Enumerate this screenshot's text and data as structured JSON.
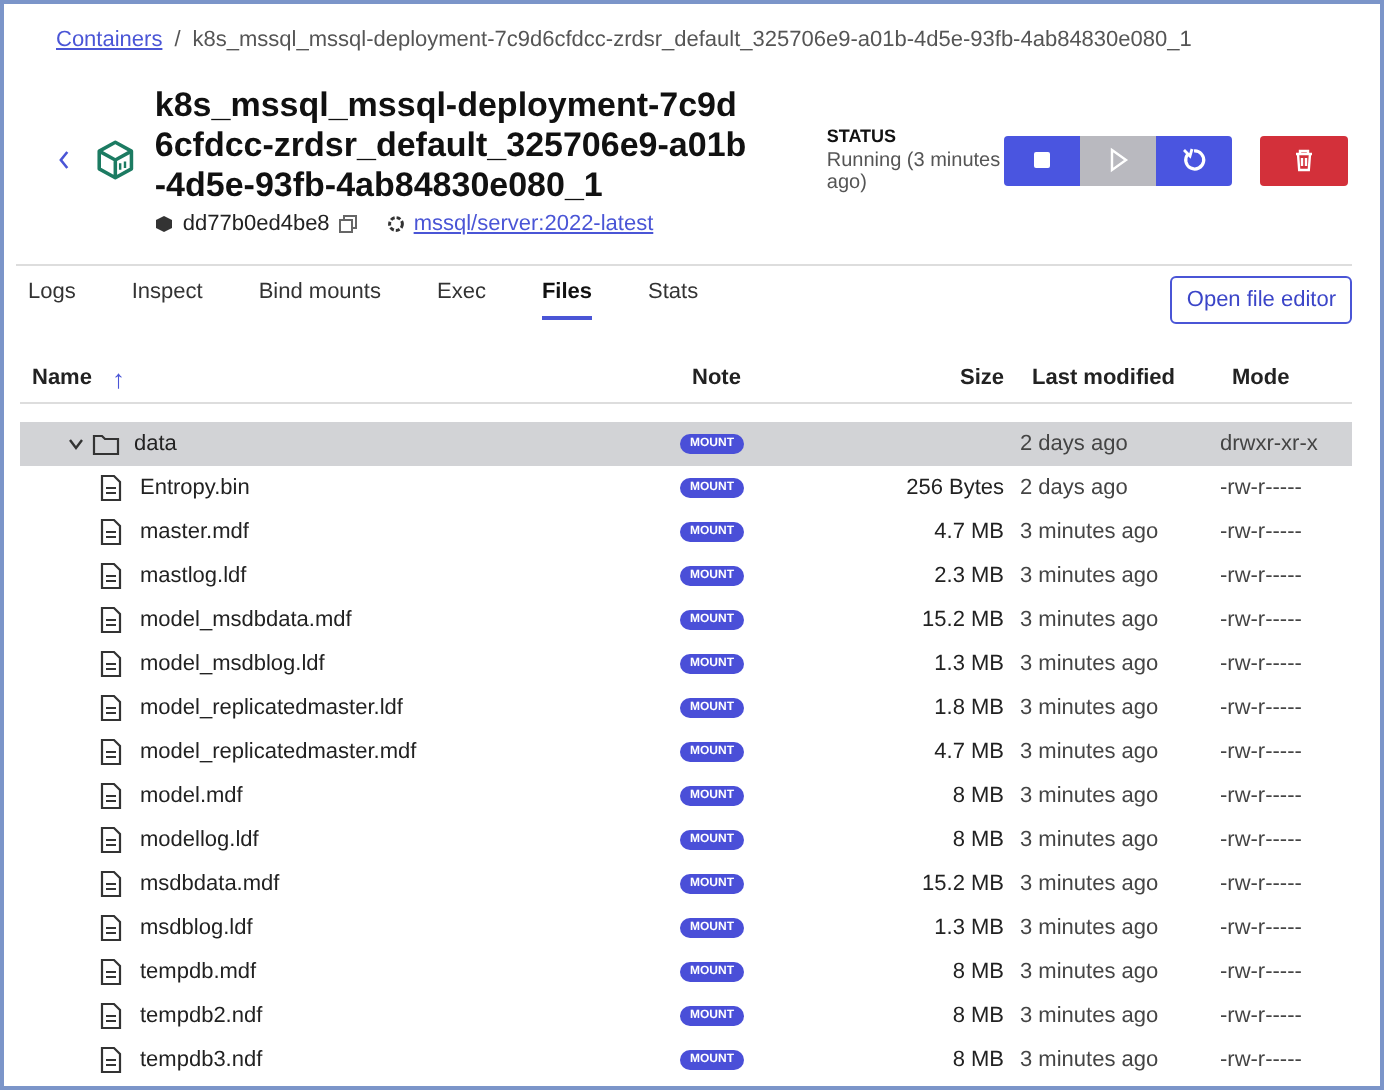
{
  "breadcrumb": {
    "link": "Containers",
    "separator": "/",
    "current": "k8s_mssql_mssql-deployment-7c9d6cfdcc-zrdsr_default_325706e9-a01b-4d5e-93fb-4ab84830e080_1"
  },
  "container": {
    "name": "k8s_mssql_mssql-deployment-7c9d6cfdcc-zrdsr_default_325706e9-a01b-4d5e-93fb-4ab84830e080_1",
    "id": "dd77b0ed4be8",
    "image": "mssql/server:2022-latest"
  },
  "status": {
    "label": "STATUS",
    "value": "Running (3 minutes ago)"
  },
  "actions": [
    {
      "kind": "stop",
      "disabled": false
    },
    {
      "kind": "start",
      "disabled": true
    },
    {
      "kind": "restart",
      "disabled": false
    },
    {
      "kind": "delete",
      "disabled": false
    }
  ],
  "tabs": [
    {
      "label": "Logs",
      "selected": false
    },
    {
      "label": "Inspect",
      "selected": false
    },
    {
      "label": "Bind mounts",
      "selected": false
    },
    {
      "label": "Exec",
      "selected": false
    },
    {
      "label": "Files",
      "selected": true
    },
    {
      "label": "Stats",
      "selected": false
    }
  ],
  "open_file_editor": "Open file editor",
  "table": {
    "columns": [
      "Name",
      "Note",
      "Size",
      "Last modified",
      "Mode"
    ],
    "sort_icon": "↑",
    "rows": [
      {
        "kind": "folder",
        "name": "data",
        "expanded": true,
        "selected": true,
        "note": "MOUNT",
        "modified": "2 days ago",
        "mode": "drwxr-xr-x",
        "children": [
          {
            "kind": "file",
            "name": "Entropy.bin",
            "selected": false,
            "note": "MOUNT",
            "size": "256 Bytes",
            "modified": "2 days ago",
            "mode": "-rw-r-----"
          },
          {
            "kind": "file",
            "name": "master.mdf",
            "selected": false,
            "note": "MOUNT",
            "size": "4.7 MB",
            "modified": "3 minutes ago",
            "mode": "-rw-r-----"
          },
          {
            "kind": "file",
            "name": "mastlog.ldf",
            "selected": false,
            "note": "MOUNT",
            "size": "2.3 MB",
            "modified": "3 minutes ago",
            "mode": "-rw-r-----"
          },
          {
            "kind": "file",
            "name": "model_msdbdata.mdf",
            "selected": false,
            "note": "MOUNT",
            "size": "15.2 MB",
            "modified": "3 minutes ago",
            "mode": "-rw-r-----"
          },
          {
            "kind": "file",
            "name": "model_msdblog.ldf",
            "selected": false,
            "note": "MOUNT",
            "size": "1.3 MB",
            "modified": "3 minutes ago",
            "mode": "-rw-r-----"
          },
          {
            "kind": "file",
            "name": "model_replicatedmaster.ldf",
            "selected": false,
            "note": "MOUNT",
            "size": "1.8 MB",
            "modified": "3 minutes ago",
            "mode": "-rw-r-----"
          },
          {
            "kind": "file",
            "name": "model_replicatedmaster.mdf",
            "selected": false,
            "note": "MOUNT",
            "size": "4.7 MB",
            "modified": "3 minutes ago",
            "mode": "-rw-r-----"
          },
          {
            "kind": "file",
            "name": "model.mdf",
            "selected": false,
            "note": "MOUNT",
            "size": "8 MB",
            "modified": "3 minutes ago",
            "mode": "-rw-r-----"
          },
          {
            "kind": "file",
            "name": "modellog.ldf",
            "selected": false,
            "note": "MOUNT",
            "size": "8 MB",
            "modified": "3 minutes ago",
            "mode": "-rw-r-----"
          },
          {
            "kind": "file",
            "name": "msdbdata.mdf",
            "selected": false,
            "note": "MOUNT",
            "size": "15.2 MB",
            "modified": "3 minutes ago",
            "mode": "-rw-r-----"
          },
          {
            "kind": "file",
            "name": "msdblog.ldf",
            "selected": false,
            "note": "MOUNT",
            "size": "1.3 MB",
            "modified": "3 minutes ago",
            "mode": "-rw-r-----"
          },
          {
            "kind": "file",
            "name": "tempdb.mdf",
            "selected": false,
            "note": "MOUNT",
            "size": "8 MB",
            "modified": "3 minutes ago",
            "mode": "-rw-r-----"
          },
          {
            "kind": "file",
            "name": "tempdb2.ndf",
            "selected": false,
            "note": "MOUNT",
            "size": "8 MB",
            "modified": "3 minutes ago",
            "mode": "-rw-r-----"
          },
          {
            "kind": "file",
            "name": "tempdb3.ndf",
            "selected": false,
            "note": "MOUNT",
            "size": "8 MB",
            "modified": "3 minutes ago",
            "mode": "-rw-r-----"
          }
        ]
      }
    ]
  }
}
